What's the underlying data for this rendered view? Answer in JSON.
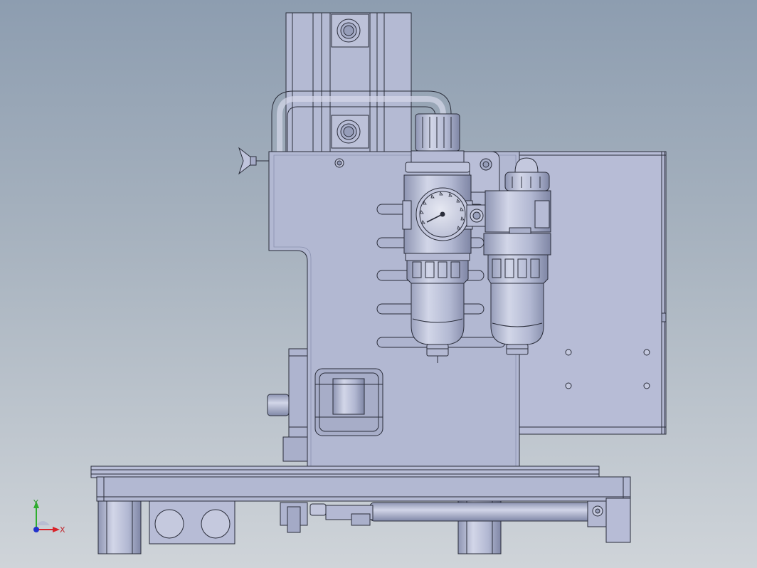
{
  "triad": {
    "x_label": "X",
    "y_label": "Y",
    "x_color": "#d8232a",
    "y_color": "#2eae2e",
    "z_color": "#2233cc"
  },
  "colors": {
    "part_fill": "#b2b8d2",
    "part_fill_light": "#c4c9df",
    "part_fill_dark": "#9ba2bf",
    "edge": "#2a2d3a"
  }
}
